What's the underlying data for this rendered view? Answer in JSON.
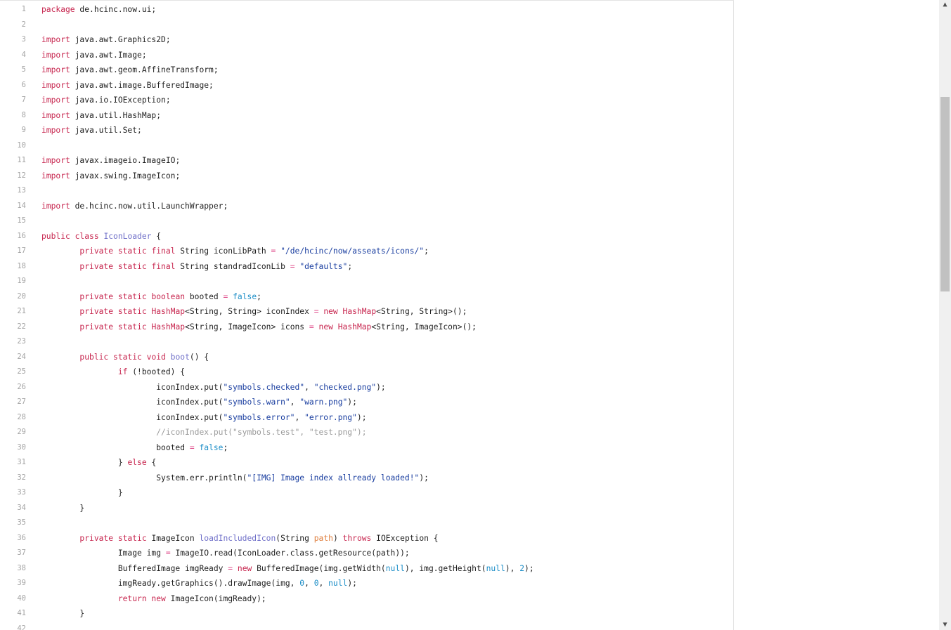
{
  "editor": {
    "lines": [
      {
        "n": "1",
        "t": [
          {
            "c": "kw",
            "s": "package"
          },
          {
            "c": "txt",
            "s": " de.hcinc.now.ui;"
          }
        ]
      },
      {
        "n": "2",
        "t": []
      },
      {
        "n": "3",
        "t": [
          {
            "c": "kw",
            "s": "import"
          },
          {
            "c": "txt",
            "s": " java.awt.Graphics2D;"
          }
        ]
      },
      {
        "n": "4",
        "t": [
          {
            "c": "kw",
            "s": "import"
          },
          {
            "c": "txt",
            "s": " java.awt.Image;"
          }
        ]
      },
      {
        "n": "5",
        "t": [
          {
            "c": "kw",
            "s": "import"
          },
          {
            "c": "txt",
            "s": " java.awt.geom.AffineTransform;"
          }
        ]
      },
      {
        "n": "6",
        "t": [
          {
            "c": "kw",
            "s": "import"
          },
          {
            "c": "txt",
            "s": " java.awt.image.BufferedImage;"
          }
        ]
      },
      {
        "n": "7",
        "t": [
          {
            "c": "kw",
            "s": "import"
          },
          {
            "c": "txt",
            "s": " java.io.IOException;"
          }
        ]
      },
      {
        "n": "8",
        "t": [
          {
            "c": "kw",
            "s": "import"
          },
          {
            "c": "txt",
            "s": " java.util.HashMap;"
          }
        ]
      },
      {
        "n": "9",
        "t": [
          {
            "c": "kw",
            "s": "import"
          },
          {
            "c": "txt",
            "s": " java.util.Set;"
          }
        ]
      },
      {
        "n": "10",
        "t": []
      },
      {
        "n": "11",
        "t": [
          {
            "c": "kw",
            "s": "import"
          },
          {
            "c": "txt",
            "s": " javax.imageio.ImageIO;"
          }
        ]
      },
      {
        "n": "12",
        "t": [
          {
            "c": "kw",
            "s": "import"
          },
          {
            "c": "txt",
            "s": " javax.swing.ImageIcon;"
          }
        ]
      },
      {
        "n": "13",
        "t": []
      },
      {
        "n": "14",
        "t": [
          {
            "c": "kw",
            "s": "import"
          },
          {
            "c": "txt",
            "s": " de.hcinc.now.util.LaunchWrapper;"
          }
        ]
      },
      {
        "n": "15",
        "t": []
      },
      {
        "n": "16",
        "t": [
          {
            "c": "kw",
            "s": "public class"
          },
          {
            "c": "txt",
            "s": " "
          },
          {
            "c": "cls",
            "s": "IconLoader"
          },
          {
            "c": "txt",
            "s": " {"
          }
        ]
      },
      {
        "n": "17",
        "t": [
          {
            "c": "txt",
            "s": "\t"
          },
          {
            "c": "kw",
            "s": "private static final"
          },
          {
            "c": "txt",
            "s": " String iconLibPath "
          },
          {
            "c": "op",
            "s": "="
          },
          {
            "c": "txt",
            "s": " "
          },
          {
            "c": "str",
            "s": "\"/de/hcinc/now/asseats/icons/\""
          },
          {
            "c": "txt",
            "s": ";"
          }
        ]
      },
      {
        "n": "18",
        "t": [
          {
            "c": "txt",
            "s": "\t"
          },
          {
            "c": "kw",
            "s": "private static final"
          },
          {
            "c": "txt",
            "s": " String standradIconLib "
          },
          {
            "c": "op",
            "s": "="
          },
          {
            "c": "txt",
            "s": " "
          },
          {
            "c": "str",
            "s": "\"defaults\""
          },
          {
            "c": "txt",
            "s": ";"
          }
        ]
      },
      {
        "n": "19",
        "t": []
      },
      {
        "n": "20",
        "t": [
          {
            "c": "txt",
            "s": "\t"
          },
          {
            "c": "kw",
            "s": "private static boolean"
          },
          {
            "c": "txt",
            "s": " booted "
          },
          {
            "c": "op",
            "s": "="
          },
          {
            "c": "txt",
            "s": " "
          },
          {
            "c": "lit",
            "s": "false"
          },
          {
            "c": "txt",
            "s": ";"
          }
        ]
      },
      {
        "n": "21",
        "t": [
          {
            "c": "txt",
            "s": "\t"
          },
          {
            "c": "kw",
            "s": "private static"
          },
          {
            "c": "txt",
            "s": " "
          },
          {
            "c": "kw",
            "s": "HashMap"
          },
          {
            "c": "txt",
            "s": "<String, String> iconIndex "
          },
          {
            "c": "op",
            "s": "="
          },
          {
            "c": "txt",
            "s": " "
          },
          {
            "c": "kw",
            "s": "new"
          },
          {
            "c": "txt",
            "s": " "
          },
          {
            "c": "kw",
            "s": "HashMap"
          },
          {
            "c": "txt",
            "s": "<String, String>();"
          }
        ]
      },
      {
        "n": "22",
        "t": [
          {
            "c": "txt",
            "s": "\t"
          },
          {
            "c": "kw",
            "s": "private static"
          },
          {
            "c": "txt",
            "s": " "
          },
          {
            "c": "kw",
            "s": "HashMap"
          },
          {
            "c": "txt",
            "s": "<String, ImageIcon> icons "
          },
          {
            "c": "op",
            "s": "="
          },
          {
            "c": "txt",
            "s": " "
          },
          {
            "c": "kw",
            "s": "new"
          },
          {
            "c": "txt",
            "s": " "
          },
          {
            "c": "kw",
            "s": "HashMap"
          },
          {
            "c": "txt",
            "s": "<String, ImageIcon>();"
          }
        ]
      },
      {
        "n": "23",
        "t": []
      },
      {
        "n": "24",
        "t": [
          {
            "c": "txt",
            "s": "\t"
          },
          {
            "c": "kw",
            "s": "public static void"
          },
          {
            "c": "txt",
            "s": " "
          },
          {
            "c": "cls",
            "s": "boot"
          },
          {
            "c": "txt",
            "s": "() {"
          }
        ]
      },
      {
        "n": "25",
        "t": [
          {
            "c": "txt",
            "s": "\t\t"
          },
          {
            "c": "kw",
            "s": "if"
          },
          {
            "c": "txt",
            "s": " (!booted) {"
          }
        ]
      },
      {
        "n": "26",
        "t": [
          {
            "c": "txt",
            "s": "\t\t\ticonIndex.put("
          },
          {
            "c": "str",
            "s": "\"symbols.checked\""
          },
          {
            "c": "txt",
            "s": ", "
          },
          {
            "c": "str",
            "s": "\"checked.png\""
          },
          {
            "c": "txt",
            "s": ");"
          }
        ]
      },
      {
        "n": "27",
        "t": [
          {
            "c": "txt",
            "s": "\t\t\ticonIndex.put("
          },
          {
            "c": "str",
            "s": "\"symbols.warn\""
          },
          {
            "c": "txt",
            "s": ", "
          },
          {
            "c": "str",
            "s": "\"warn.png\""
          },
          {
            "c": "txt",
            "s": ");"
          }
        ]
      },
      {
        "n": "28",
        "t": [
          {
            "c": "txt",
            "s": "\t\t\ticonIndex.put("
          },
          {
            "c": "str",
            "s": "\"symbols.error\""
          },
          {
            "c": "txt",
            "s": ", "
          },
          {
            "c": "str",
            "s": "\"error.png\""
          },
          {
            "c": "txt",
            "s": ");"
          }
        ]
      },
      {
        "n": "29",
        "t": [
          {
            "c": "txt",
            "s": "\t\t\t"
          },
          {
            "c": "cmt",
            "s": "//iconIndex.put(\"symbols.test\", \"test.png\");"
          }
        ]
      },
      {
        "n": "30",
        "t": [
          {
            "c": "txt",
            "s": "\t\t\tbooted "
          },
          {
            "c": "op",
            "s": "="
          },
          {
            "c": "txt",
            "s": " "
          },
          {
            "c": "lit",
            "s": "false"
          },
          {
            "c": "txt",
            "s": ";"
          }
        ]
      },
      {
        "n": "31",
        "t": [
          {
            "c": "txt",
            "s": "\t\t} "
          },
          {
            "c": "kw",
            "s": "else"
          },
          {
            "c": "txt",
            "s": " {"
          }
        ]
      },
      {
        "n": "32",
        "t": [
          {
            "c": "txt",
            "s": "\t\t\tSystem.err.println("
          },
          {
            "c": "str",
            "s": "\"[IMG] Image index allready loaded!\""
          },
          {
            "c": "txt",
            "s": ");"
          }
        ]
      },
      {
        "n": "33",
        "t": [
          {
            "c": "txt",
            "s": "\t\t}"
          }
        ]
      },
      {
        "n": "34",
        "t": [
          {
            "c": "txt",
            "s": "\t}"
          }
        ]
      },
      {
        "n": "35",
        "t": []
      },
      {
        "n": "36",
        "t": [
          {
            "c": "txt",
            "s": "\t"
          },
          {
            "c": "kw",
            "s": "private static"
          },
          {
            "c": "txt",
            "s": " ImageIcon "
          },
          {
            "c": "cls",
            "s": "loadIncludedIcon"
          },
          {
            "c": "txt",
            "s": "(String "
          },
          {
            "c": "par",
            "s": "path"
          },
          {
            "c": "txt",
            "s": ") "
          },
          {
            "c": "kw",
            "s": "throws"
          },
          {
            "c": "txt",
            "s": " IOException {"
          }
        ]
      },
      {
        "n": "37",
        "t": [
          {
            "c": "txt",
            "s": "\t\tImage img "
          },
          {
            "c": "op",
            "s": "="
          },
          {
            "c": "txt",
            "s": " ImageIO.read(IconLoader.class.getResource(path));"
          }
        ]
      },
      {
        "n": "38",
        "t": [
          {
            "c": "txt",
            "s": "\t\tBufferedImage imgReady "
          },
          {
            "c": "op",
            "s": "="
          },
          {
            "c": "txt",
            "s": " "
          },
          {
            "c": "kw",
            "s": "new"
          },
          {
            "c": "txt",
            "s": " BufferedImage(img.getWidth("
          },
          {
            "c": "lit",
            "s": "null"
          },
          {
            "c": "txt",
            "s": "), img.getHeight("
          },
          {
            "c": "lit",
            "s": "null"
          },
          {
            "c": "txt",
            "s": "), "
          },
          {
            "c": "lit",
            "s": "2"
          },
          {
            "c": "txt",
            "s": ");"
          }
        ]
      },
      {
        "n": "39",
        "t": [
          {
            "c": "txt",
            "s": "\t\timgReady.getGraphics().drawImage(img, "
          },
          {
            "c": "lit",
            "s": "0"
          },
          {
            "c": "txt",
            "s": ", "
          },
          {
            "c": "lit",
            "s": "0"
          },
          {
            "c": "txt",
            "s": ", "
          },
          {
            "c": "lit",
            "s": "null"
          },
          {
            "c": "txt",
            "s": ");"
          }
        ]
      },
      {
        "n": "40",
        "t": [
          {
            "c": "txt",
            "s": "\t\t"
          },
          {
            "c": "kw",
            "s": "return new"
          },
          {
            "c": "txt",
            "s": " ImageIcon(imgReady);"
          }
        ]
      },
      {
        "n": "41",
        "t": [
          {
            "c": "txt",
            "s": "\t}"
          }
        ]
      },
      {
        "n": "42",
        "t": []
      }
    ]
  },
  "scrollbar": {
    "up_icon": "▲",
    "down_icon": "▼"
  }
}
